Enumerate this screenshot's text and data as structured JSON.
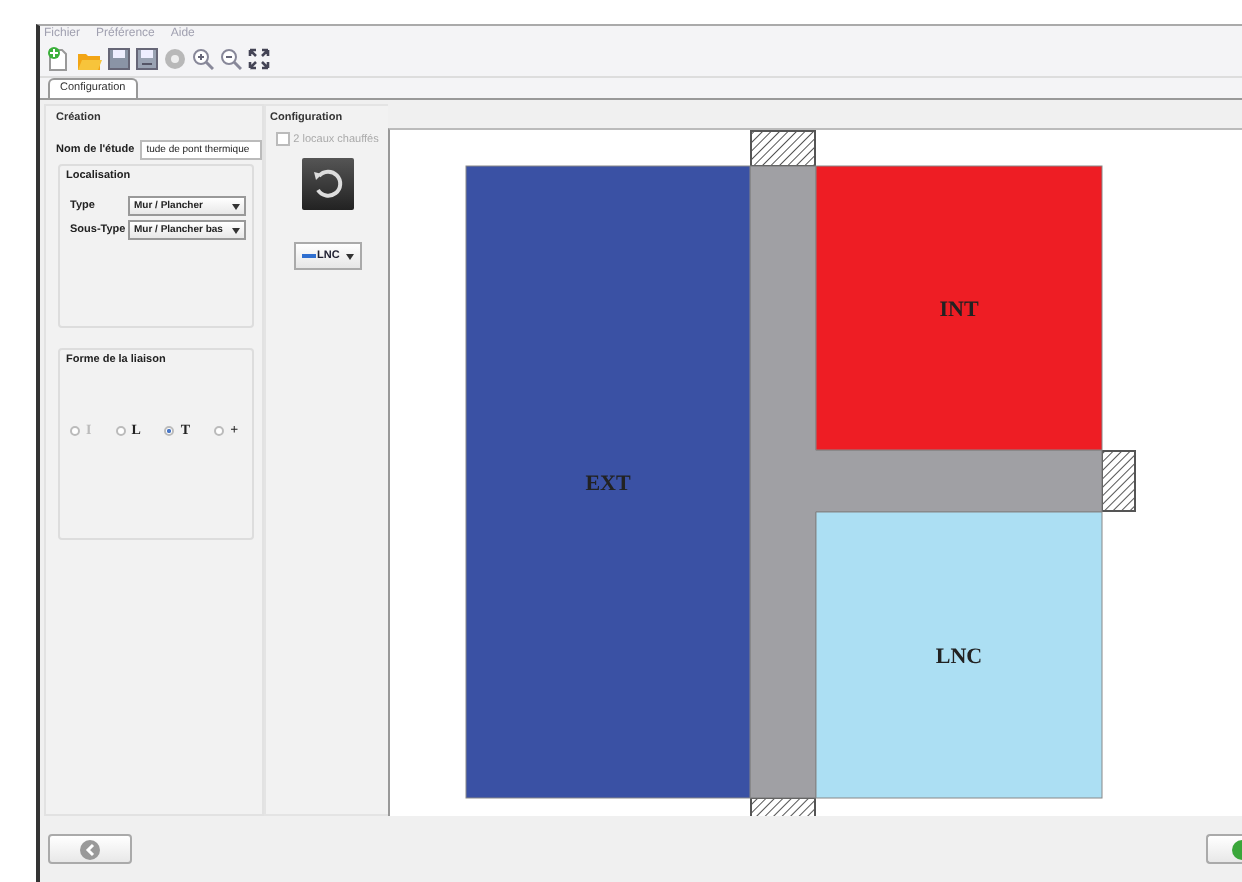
{
  "menu": [
    "Fichier",
    "Préférence",
    "Aide"
  ],
  "tabs": [
    {
      "label": "Configuration",
      "selected": true
    }
  ],
  "creation": {
    "title": "Création",
    "study_label": "Nom de l'étude",
    "study_value": "tude de pont thermique",
    "localisation": {
      "title": "Localisation",
      "type_label": "Type",
      "type_value": "Mur / Plancher",
      "subtype_label": "Sous-Type",
      "subtype_value": "Mur / Plancher bas"
    },
    "liaison": {
      "title": "Forme de la liaison",
      "options": [
        {
          "label": "I",
          "selected": false,
          "disabled": true
        },
        {
          "label": "L",
          "selected": false,
          "disabled": false
        },
        {
          "label": "T",
          "selected": true,
          "disabled": false
        },
        {
          "label": "+",
          "selected": false,
          "disabled": false
        }
      ]
    }
  },
  "configuration": {
    "title": "Configuration",
    "heated_checkbox": {
      "label": "2 locaux chauffés",
      "checked": false,
      "disabled": true
    },
    "zone_select": {
      "value": "LNC"
    }
  },
  "diagram": {
    "zones": [
      {
        "label": "EXT",
        "color": "#3a51a4"
      },
      {
        "label": "INT",
        "color": "#ee1d24"
      },
      {
        "label": "LNC",
        "color": "#acdff3"
      }
    ]
  }
}
